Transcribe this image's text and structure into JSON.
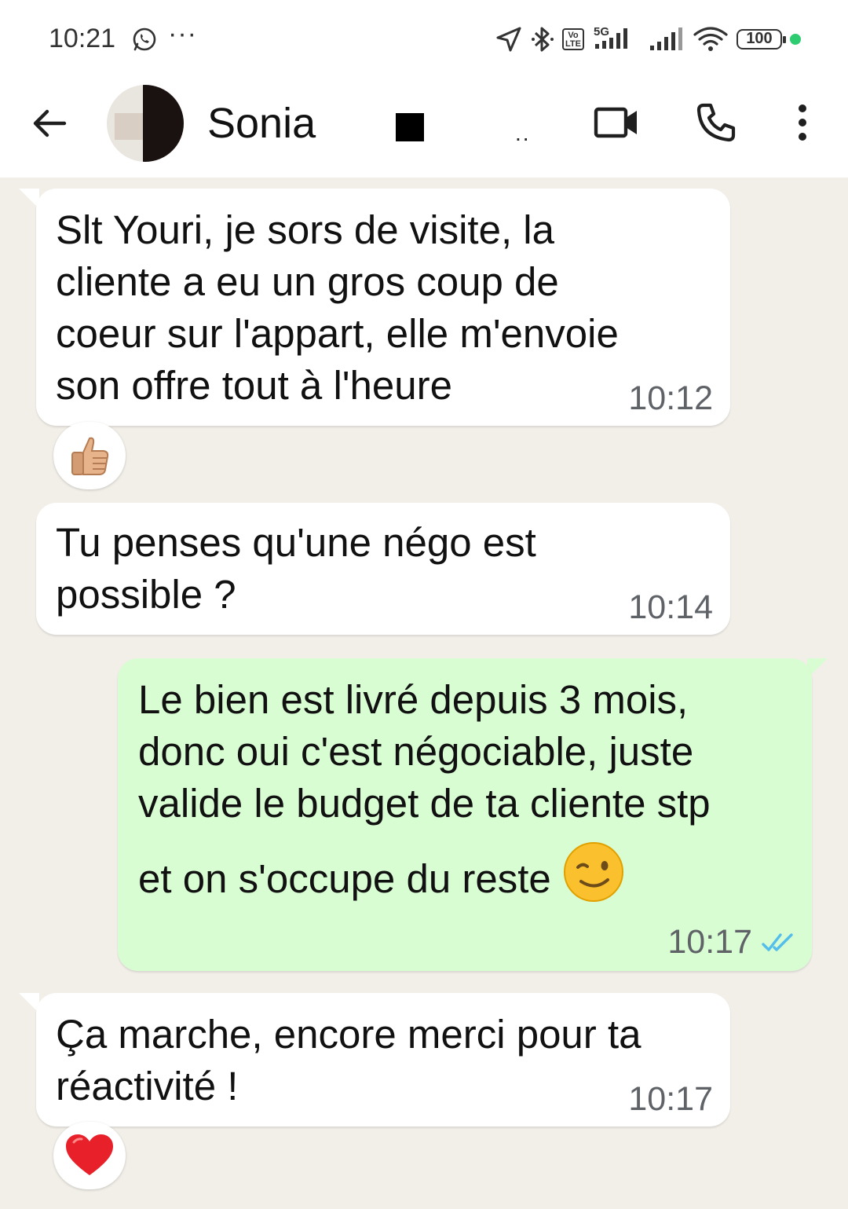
{
  "status_bar": {
    "time": "10:21",
    "overflow": "···",
    "network": "5G",
    "volte": "Vo LTE",
    "battery": "100"
  },
  "header": {
    "contact_name": "Sonia",
    "status_dots": "..",
    "icons": [
      "back-arrow-icon",
      "video-call-icon",
      "voice-call-icon",
      "more-vert-icon"
    ]
  },
  "messages": [
    {
      "direction": "incoming",
      "lines": [
        "Slt Youri, je sors de visite, la",
        "cliente a eu un gros coup de",
        "coeur sur l'appart, elle m'envoie",
        "son offre tout à l'heure"
      ],
      "time": "10:12",
      "reaction": "thumbs-up-icon"
    },
    {
      "direction": "incoming",
      "lines": [
        "Tu penses qu'une négo est",
        "possible ?"
      ],
      "time": "10:14"
    },
    {
      "direction": "outgoing",
      "lines": [
        "Le bien est livré depuis 3 mois,",
        "donc oui c'est négociable, juste",
        "valide le budget de ta cliente stp",
        "et on s'occupe du reste"
      ],
      "inline_emoji": "wink-smile-icon",
      "time": "10:17",
      "status": "read",
      "tick_color": "#53bdeb"
    },
    {
      "direction": "incoming",
      "lines": [
        "Ça marche, encore merci pour ta",
        "réactivité !"
      ],
      "time": "10:17",
      "reaction": "red-heart-icon"
    }
  ],
  "colors": {
    "chat_bg": "#f2efe9",
    "incoming_bubble": "#ffffff",
    "outgoing_bubble": "#d9fdd3",
    "read_ticks": "#53bdeb"
  }
}
